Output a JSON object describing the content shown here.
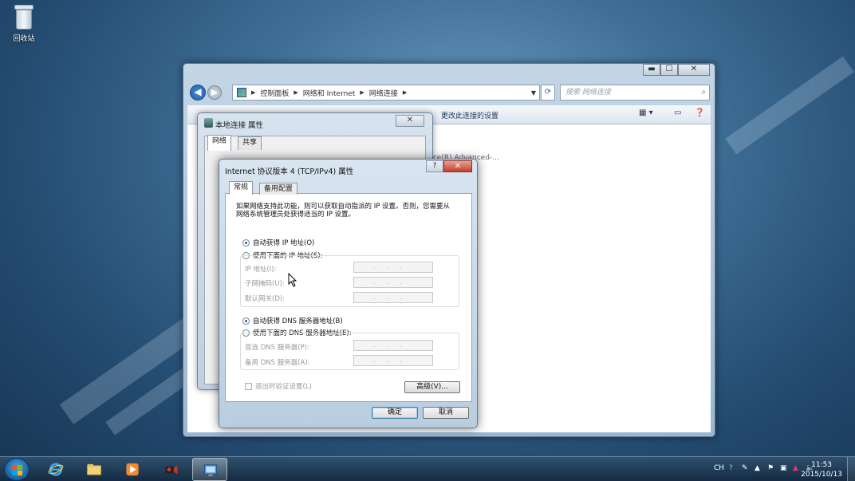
{
  "desktop": {
    "recycle_bin_label": "回收站"
  },
  "explorer": {
    "window_controls": {
      "minimize": "▬",
      "maximize": "☐",
      "close": "✕"
    },
    "breadcrumb": [
      "控制面板",
      "网络和 Internet",
      "网络连接"
    ],
    "search_placeholder": "搜索 网络连接",
    "command_link": "更改此连接的设置",
    "ghost_text": "vice(R) Advanced-..."
  },
  "local_conn_dialog": {
    "title": "本地连接 属性",
    "tabs": [
      "网络",
      "共享"
    ],
    "close_glyph": "✕"
  },
  "ip_dialog": {
    "title": "Internet 协议版本 4 (TCP/IPv4) 属性",
    "help_glyph": "?",
    "close_glyph": "✕",
    "tabs": [
      "常规",
      "备用配置"
    ],
    "description": "如果网络支持此功能，则可以获取自动指派的 IP 设置。否则，您需要从网络系统管理员处获得适当的 IP 设置。",
    "ip_auto_label": "自动获得 IP 地址(O)",
    "ip_manual_label": "使用下面的 IP 地址(S):",
    "ip_fields": [
      "IP 地址(I):",
      "子网掩码(U):",
      "默认网关(D):"
    ],
    "dns_auto_label": "自动获得 DNS 服务器地址(B)",
    "dns_manual_label": "使用下面的 DNS 服务器地址(E):",
    "dns_fields": [
      "首选 DNS 服务器(P):",
      "备用 DNS 服务器(A):"
    ],
    "ip_blank": "...",
    "validate_label": "退出时验证设置(L)",
    "advanced_button": "高级(V)...",
    "ok_button": "确定",
    "cancel_button": "取消",
    "ip_auto_selected": true,
    "dns_auto_selected": true
  },
  "taskbar": {
    "lang": "CH",
    "time": "11:53",
    "date": "2015/10/13"
  },
  "colors": {
    "accent": "#1f5fa6",
    "close_red": "#c2402a",
    "window_chrome": "#c4d6e6"
  }
}
